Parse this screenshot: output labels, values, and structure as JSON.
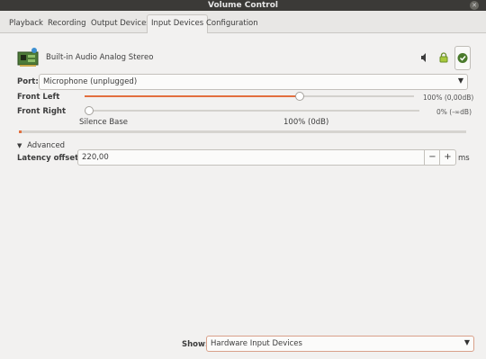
{
  "window": {
    "title": "Volume Control"
  },
  "tabs": [
    {
      "label": "Playback"
    },
    {
      "label": "Recording"
    },
    {
      "label": "Output Devices"
    },
    {
      "label": "Input Devices"
    },
    {
      "label": "Configuration"
    }
  ],
  "active_tab": "Input Devices",
  "device": {
    "name": "Built-in Audio Analog Stereo",
    "port_label": "Port:",
    "port_value": "Microphone (unplugged)",
    "icons": [
      "audio-card-icon",
      "speaker-mute-icon",
      "lock-icon",
      "checkmark-icon"
    ]
  },
  "channels": [
    {
      "label": "Front Left",
      "volume_text": "100% (0,00dB)",
      "level": 0.65
    },
    {
      "label": "Front Right",
      "volume_text": "0% (-∞dB)",
      "level": 0.0
    }
  ],
  "scale": {
    "min_label": "Silence Base",
    "mid_label": "100% (0dB)"
  },
  "peak_level": 0.005,
  "advanced": {
    "label": "Advanced"
  },
  "latency": {
    "label": "Latency offset:",
    "value": "220,00",
    "unit": "ms",
    "minus": "−",
    "plus": "+"
  },
  "show": {
    "label": "Show:",
    "value": "Hardware Input Devices"
  },
  "colors": {
    "accent": "#e26f3f",
    "titlebar": "#3b3a37"
  }
}
